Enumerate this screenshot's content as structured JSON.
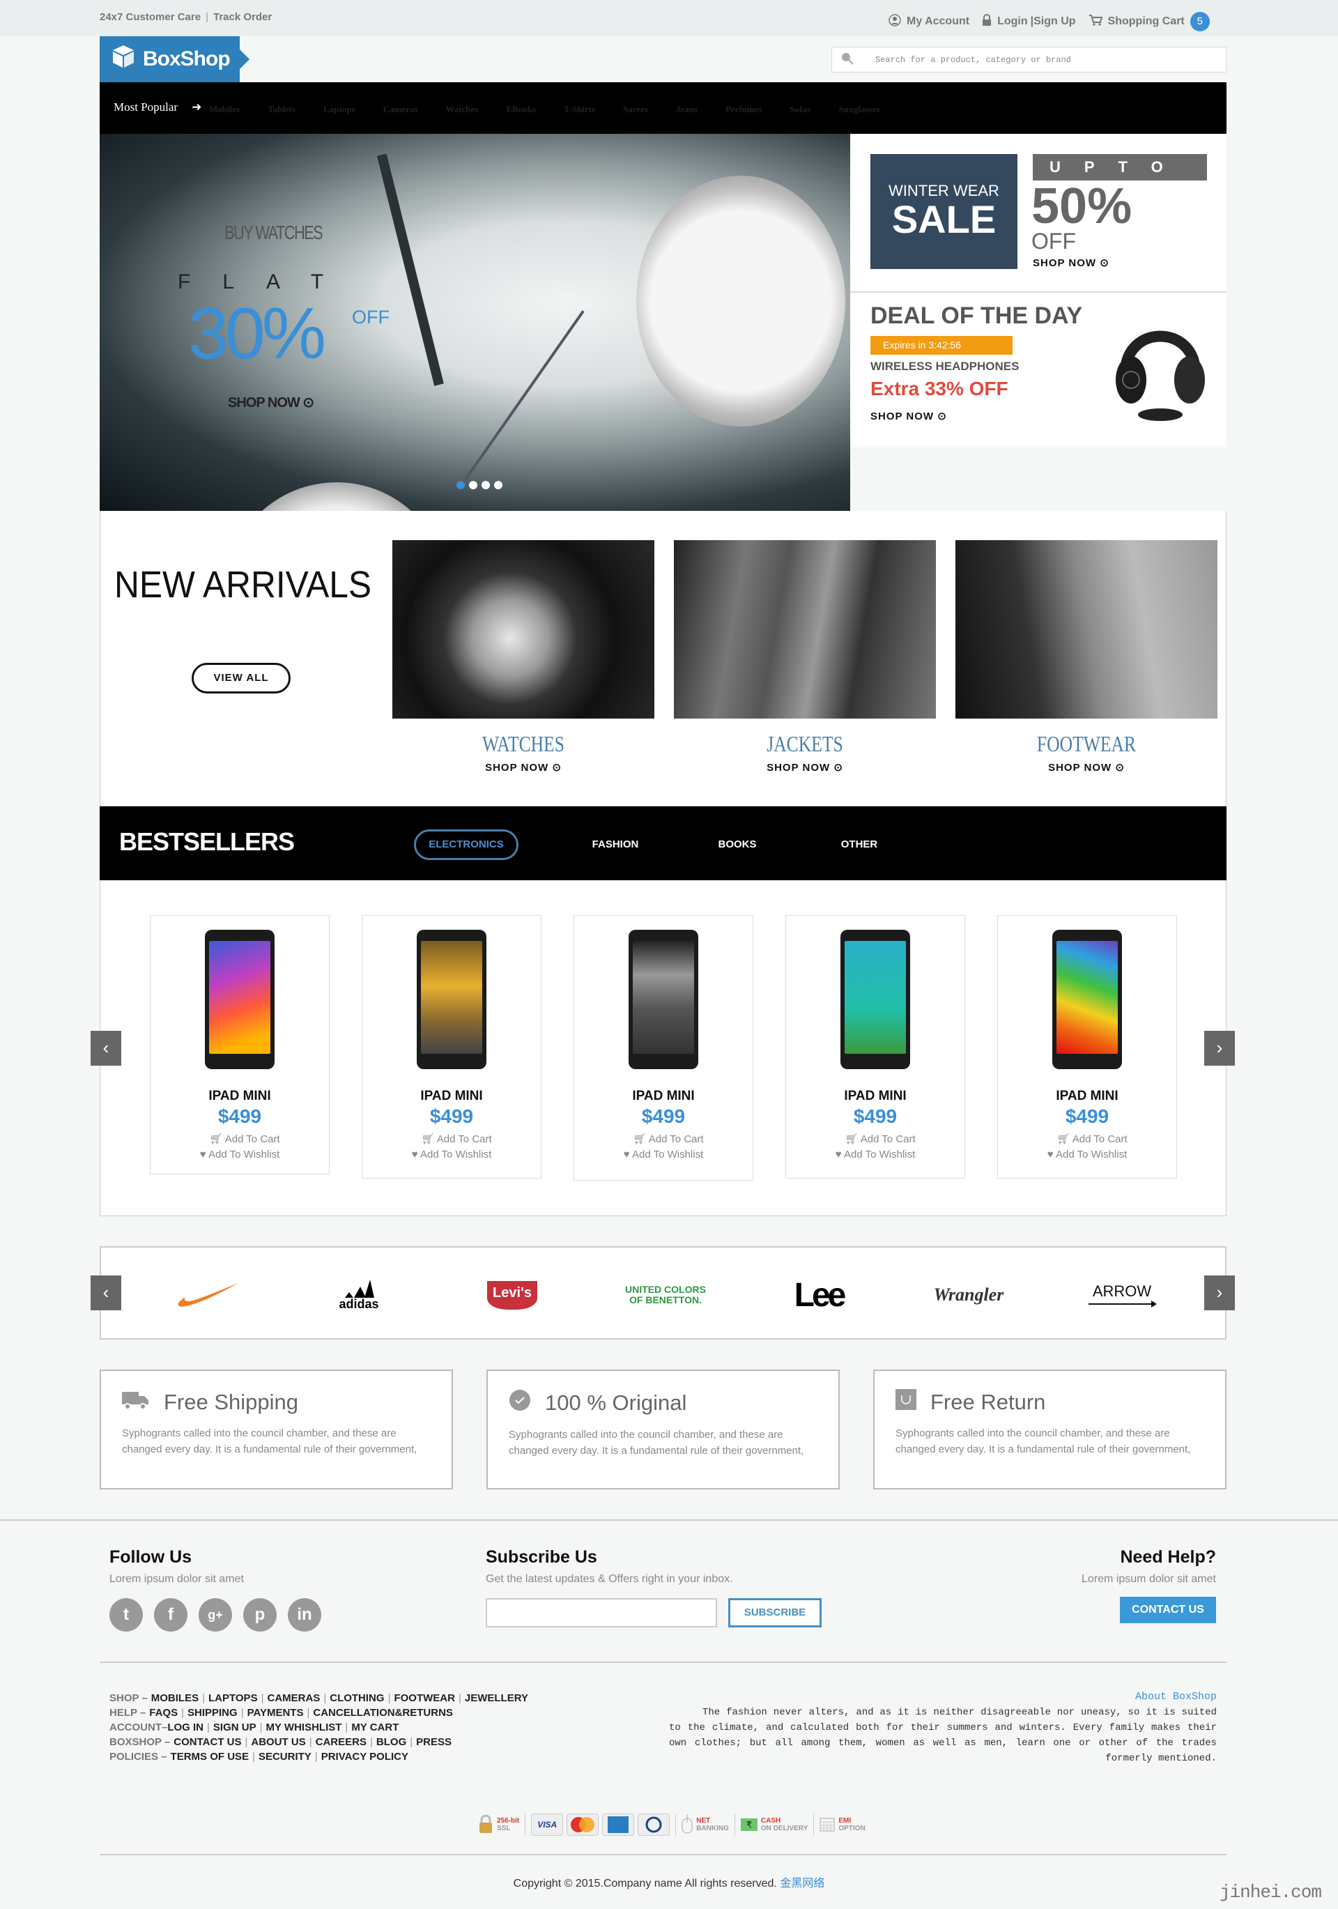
{
  "topbar": {
    "customer_care": "24x7 Customer Care",
    "separator": "|",
    "track_order": "Track Order",
    "my_account": "My Account",
    "login": "Login",
    "signup": "|Sign Up",
    "cart": "Shopping Cart",
    "cart_count": "5"
  },
  "brand": {
    "name": "BoxShop",
    "color": "#2e7fba"
  },
  "search": {
    "placeholder": "Search for a product, category or brand"
  },
  "nav": {
    "most_popular": "Most Popular",
    "items": [
      "Mobiles",
      "Tablets",
      "Laptops",
      "Cameras",
      "Watches",
      "EBooks",
      "T-Shirts",
      "Sarees",
      "Jeans",
      "Perfumes",
      "Sofas",
      "Sunglasses"
    ]
  },
  "hero": {
    "buy": "BUY WATCHES",
    "flat": "FLAT",
    "percent": "30%",
    "off": "OFF",
    "shop_now": "SHOP NOW",
    "slides": 4,
    "active_slide": 1
  },
  "promo": {
    "winter_wear": "WINTER WEAR",
    "sale": "SALE",
    "upto": "UPTO",
    "percent": "50%",
    "off": "OFF",
    "shop_now": "SHOP NOW"
  },
  "deal": {
    "title": "DEAL OF THE DAY",
    "expires": "Expires in 3:42:56",
    "product": "WIRELESS HEADPHONES",
    "offer": "Extra 33% OFF",
    "shop_now": "SHOP NOW"
  },
  "arrivals": {
    "title": "NEW ARRIVALS",
    "view_all": "VIEW ALL",
    "categories": [
      {
        "name": "WATCHES",
        "cta": "SHOP NOW"
      },
      {
        "name": "JACKETS",
        "cta": "SHOP NOW"
      },
      {
        "name": "FOOTWEAR",
        "cta": "SHOP NOW"
      }
    ]
  },
  "bestsellers": {
    "title": "BESTSELLERS",
    "tabs": [
      "ELECTRONICS",
      "FASHION",
      "BOOKS",
      "OTHER"
    ],
    "active_tab": "ELECTRONICS",
    "products": [
      {
        "name": "IPAD MINI",
        "price": "$499",
        "cart": "Add To Cart",
        "wishlist": "Add To Wishlist"
      },
      {
        "name": "IPAD MINI",
        "price": "$499",
        "cart": "Add To Cart",
        "wishlist": "Add To Wishlist"
      },
      {
        "name": "IPAD MINI",
        "price": "$499",
        "cart": "Add To Cart",
        "wishlist": "Add To Wishlist"
      },
      {
        "name": "IPAD MINI",
        "price": "$499",
        "cart": "Add To Cart",
        "wishlist": "Add To Wishlist"
      },
      {
        "name": "IPAD MINI",
        "price": "$499",
        "cart": "Add To Cart",
        "wishlist": "Add To Wishlist"
      }
    ]
  },
  "brands": [
    "Nike",
    "adidas",
    "Levi's",
    "UNITED COLORS OF BENETTON.",
    "Lee",
    "Wrangler",
    "ARROW"
  ],
  "features": [
    {
      "title": "Free Shipping",
      "text": "Syphogrants called into the council chamber, and these are changed every day. It is a fundamental rule of their government,"
    },
    {
      "title": "100 % Original",
      "text": "Syphogrants called into the council chamber, and these are changed every day. It is a fundamental rule of their government,"
    },
    {
      "title": "Free Return",
      "text": "Syphogrants called into the council chamber, and these are changed every day. It is a fundamental rule of their government,"
    }
  ],
  "footer": {
    "follow": {
      "title": "Follow Us",
      "text": "Lorem ipsum dolor sit amet",
      "networks": [
        "twitter",
        "facebook",
        "google-plus",
        "pinterest",
        "linkedin"
      ]
    },
    "subscribe": {
      "title": "Subscribe Us",
      "text": "Get the latest updates & Offers right in your inbox.",
      "input_value": "",
      "button": "SUBSCRIBE"
    },
    "help": {
      "title": "Need Help?",
      "text": "Lorem ipsum dolor sit amet",
      "button": "CONTACT US"
    },
    "link_groups": [
      {
        "label": "SHOP –",
        "links": [
          "MOBILES",
          "LAPTOPS",
          "CAMERAS",
          "CLOTHING",
          "FOOTWEAR",
          "JEWELLERY"
        ]
      },
      {
        "label": "HELP –",
        "links": [
          "FAQS",
          "SHIPPING",
          "PAYMENTS",
          "CANCELLATION&RETURNS"
        ]
      },
      {
        "label": "ACCOUNT–",
        "links": [
          "LOG IN",
          "SIGN UP",
          "MY WHISHLIST",
          "MY CART"
        ]
      },
      {
        "label": "BOXSHOP –",
        "links": [
          "CONTACT US",
          "ABOUT US",
          "CAREERS",
          "BLOG",
          "PRESS"
        ]
      },
      {
        "label": "POLICIES –",
        "links": [
          "TERMS OF USE",
          "SECURITY",
          "PRIVACY POLICY"
        ]
      }
    ],
    "about": {
      "title": "About BoxShop",
      "text": "The fashion never alters, and as it is neither disagreeable nor uneasy, so it is suited to the climate, and calculated both for their summers and winters. Every family makes their own clothes; but all among them, women as well as men, learn one or other of the trades formerly mentioned."
    },
    "payments": {
      "ssl_top": "256-bit",
      "ssl_bottom": "SSL",
      "cards": [
        "VISA",
        "MasterCard",
        "AMERICAN EXPRESS",
        "Diners Club International"
      ],
      "net_top": "NET",
      "net_bottom": "BANKING",
      "cod_top": "CASH",
      "cod_bottom": "ON DELIVERY",
      "emi_top": "EMI",
      "emi_bottom": "OPTION"
    },
    "copyright": "Copyright © 2015.Company name All rights reserved.",
    "copyright_link": "金黑网络"
  },
  "watermark": "jinhei.com"
}
